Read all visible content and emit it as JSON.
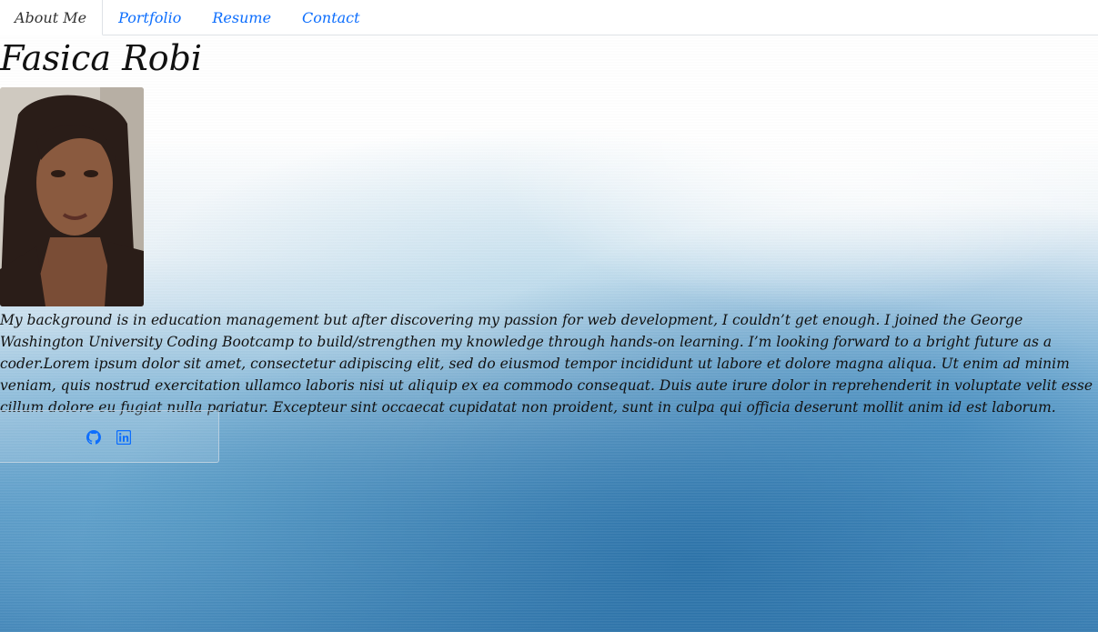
{
  "nav": {
    "tabs": [
      {
        "label": "About Me",
        "active": true
      },
      {
        "label": "Portfolio",
        "active": false
      },
      {
        "label": "Resume",
        "active": false
      },
      {
        "label": "Contact",
        "active": false
      }
    ]
  },
  "header": {
    "name": "Fasica Robi"
  },
  "about": {
    "bio": "My background is in education management but after discovering my passion for web development, I couldn’t get enough. I joined the George Washington University Coding Bootcamp to build/strengthen my knowledge through hands-on learning. I’m looking forward to a bright future as a coder.Lorem ipsum dolor sit amet, consectetur adipiscing elit, sed do eiusmod tempor incididunt ut labore et dolore magna aliqua. Ut enim ad minim veniam, quis nostrud exercitation ullamco laboris nisi ut aliquip ex ea commodo consequat. Duis aute irure dolor in reprehenderit in voluptate velit esse cillum dolore eu fugiat nulla pariatur. Excepteur sint occaecat cupidatat non proident, sunt in culpa qui officia deserunt mollit anim id est laborum."
  },
  "social": {
    "icons": [
      "github-icon",
      "linkedin-icon"
    ],
    "link_color": "#0d6efd"
  }
}
